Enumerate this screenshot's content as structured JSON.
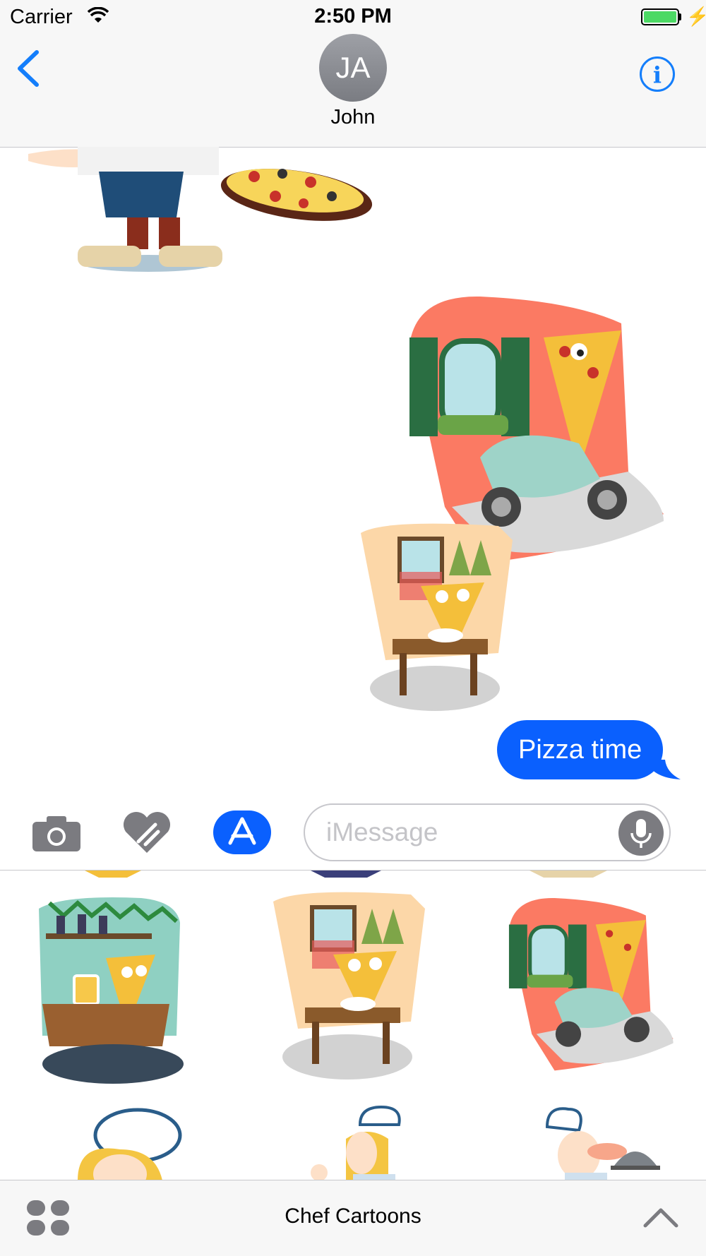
{
  "status_bar": {
    "carrier": "Carrier",
    "time": "2:50 PM"
  },
  "nav": {
    "avatar_initials": "JA",
    "contact_name": "John",
    "info_glyph": "i"
  },
  "messages": [
    {
      "kind": "sticker",
      "icon": "chef-pizza-sticker"
    },
    {
      "kind": "sticker",
      "icon": "pizza-scooter-sticker"
    },
    {
      "kind": "sticker",
      "icon": "pizza-restaurant-sticker"
    },
    {
      "kind": "text",
      "text": "Pizza time",
      "color": "#0a60fe"
    }
  ],
  "compose": {
    "placeholder": "iMessage"
  },
  "drawer": {
    "title": "Chef Cartoons",
    "stickers": [
      "pizza-bar-sticker",
      "pizza-restaurant-sticker",
      "pizza-scooter-sticker",
      "chef-woman-sticker",
      "chef-ok-sticker",
      "chef-cloche-sticker"
    ]
  },
  "colors": {
    "accent": "#147efb",
    "bubble": "#0a60fe",
    "battery": "#4cd964"
  }
}
